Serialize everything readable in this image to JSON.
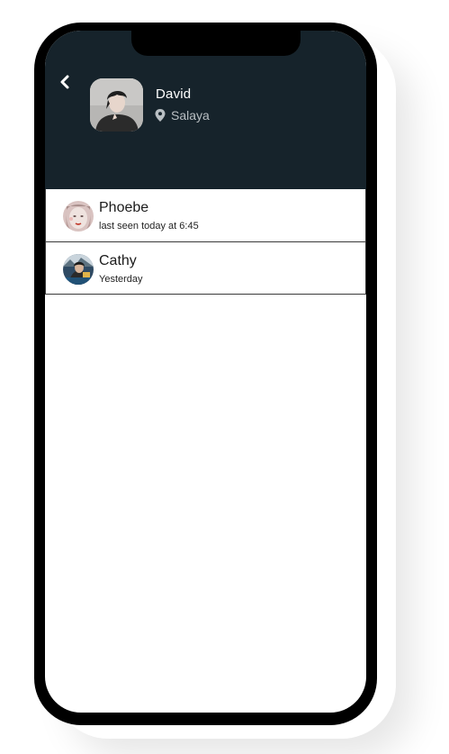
{
  "profile": {
    "name": "David",
    "location": "Salaya"
  },
  "chats": [
    {
      "name": "Phoebe",
      "status": "last seen today at 6:45"
    },
    {
      "name": "Cathy",
      "status": "Yesterday"
    }
  ],
  "colors": {
    "header_bg": "#16232b",
    "phone_frame": "#000000",
    "screen_bg": "#ffffff"
  },
  "icons": {
    "back": "chevron-left-icon",
    "location": "map-pin-icon"
  }
}
